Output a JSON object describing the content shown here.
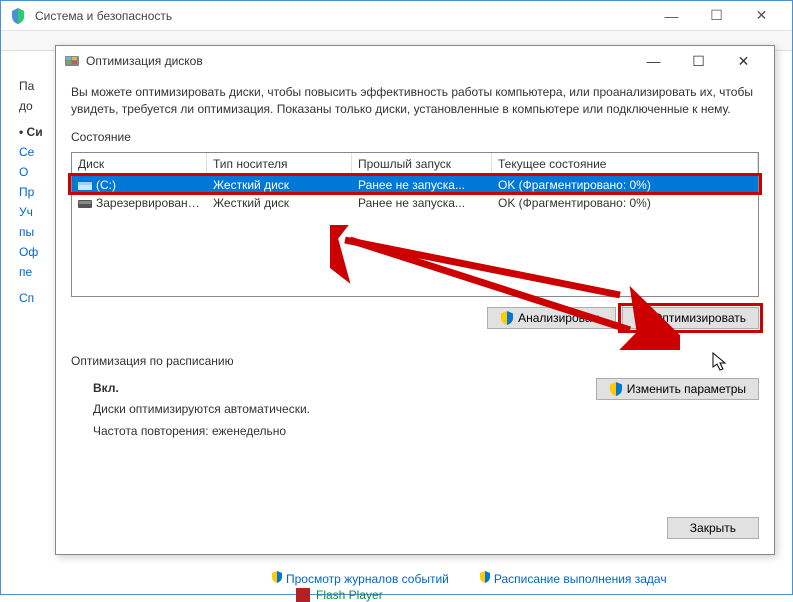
{
  "parent": {
    "title": "Система и безопасность",
    "controls": {
      "min": "—",
      "max": "☐",
      "close": "✕"
    }
  },
  "sidebar": {
    "items": [
      "Па",
      "до",
      "Си",
      "Се",
      "О",
      "Пр",
      "Уч",
      "пы",
      "Оф",
      "пе",
      "Сп"
    ]
  },
  "dialog": {
    "title": "Оптимизация дисков",
    "controls": {
      "min": "—",
      "max": "☐",
      "close": "✕"
    },
    "description": "Вы можете оптимизировать диски, чтобы повысить эффективность работы компьютера, или проанализировать их, чтобы увидеть, требуется ли оптимизация. Показаны только диски, установленные в компьютере или подключенные к нему.",
    "state_label": "Состояние",
    "table": {
      "headers": {
        "disk": "Диск",
        "media": "Тип носителя",
        "last": "Прошлый запуск",
        "status": "Текущее состояние"
      },
      "rows": [
        {
          "disk": "(C:)",
          "media": "Жесткий диск",
          "last": "Ранее не запуска...",
          "status": "OK (Фрагментировано: 0%)",
          "selected": true
        },
        {
          "disk": "Зарезервировано ...",
          "media": "Жесткий диск",
          "last": "Ранее не запуска...",
          "status": "OK (Фрагментировано: 0%)",
          "selected": false
        }
      ]
    },
    "buttons": {
      "analyze": "Анализировать",
      "optimize": "Оптимизировать"
    },
    "schedule": {
      "title": "Оптимизация по расписанию",
      "on": "Вкл.",
      "line1": "Диски оптимизируются автоматически.",
      "line2": "Частота повторения: еженедельно",
      "change": "Изменить параметры"
    },
    "close": "Закрыть"
  },
  "bottom_links": {
    "l1": "Просмотр журналов событий",
    "l2": "Расписание выполнения задач",
    "l3": "Flash Player"
  }
}
